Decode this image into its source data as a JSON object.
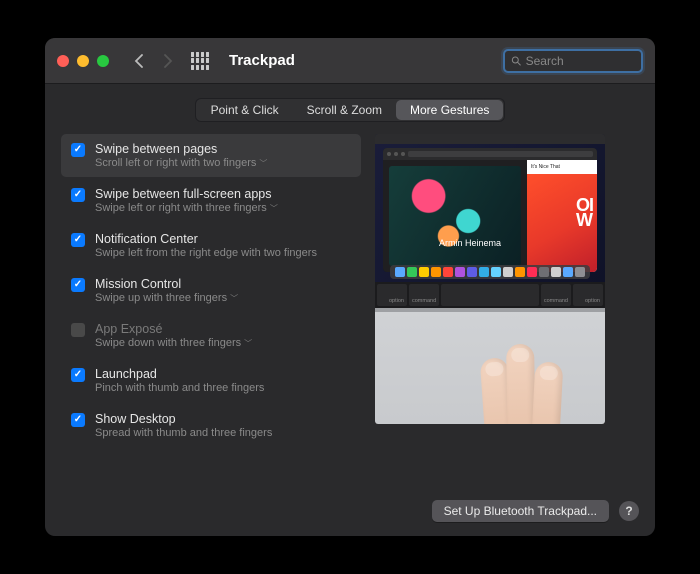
{
  "header": {
    "title": "Trackpad",
    "search_placeholder": "Search"
  },
  "tabs": [
    {
      "label": "Point & Click",
      "active": false
    },
    {
      "label": "Scroll & Zoom",
      "active": false
    },
    {
      "label": "More Gestures",
      "active": true
    }
  ],
  "options": [
    {
      "title": "Swipe between pages",
      "sub": "Scroll left or right with two fingers",
      "checked": true,
      "dropdown": true,
      "selected": true,
      "disabled": false
    },
    {
      "title": "Swipe between full-screen apps",
      "sub": "Swipe left or right with three fingers",
      "checked": true,
      "dropdown": true,
      "selected": false,
      "disabled": false
    },
    {
      "title": "Notification Center",
      "sub": "Swipe left from the right edge with two fingers",
      "checked": true,
      "dropdown": false,
      "selected": false,
      "disabled": false
    },
    {
      "title": "Mission Control",
      "sub": "Swipe up with three fingers",
      "checked": true,
      "dropdown": true,
      "selected": false,
      "disabled": false
    },
    {
      "title": "App Exposé",
      "sub": "Swipe down with three fingers",
      "checked": false,
      "dropdown": true,
      "selected": false,
      "disabled": true
    },
    {
      "title": "Launchpad",
      "sub": "Pinch with thumb and three fingers",
      "checked": true,
      "dropdown": false,
      "selected": false,
      "disabled": false
    },
    {
      "title": "Show Desktop",
      "sub": "Spread with thumb and three fingers",
      "checked": true,
      "dropdown": false,
      "selected": false,
      "disabled": false
    }
  ],
  "preview": {
    "person_name": "Armin Heinema",
    "right_header": "It's Nice That",
    "big_text": "OI\nW",
    "keys": [
      "option",
      "command",
      "",
      "command",
      "option"
    ],
    "dock_colors": [
      "#5aa9ff",
      "#34c759",
      "#ffcc00",
      "#ff9500",
      "#ff453a",
      "#af52de",
      "#5e5ce6",
      "#32ade6",
      "#64d2ff",
      "#cfcfcf",
      "#ff9500",
      "#ff2d55",
      "#6e6e73",
      "#cfcfcf",
      "#5aa9ff",
      "#8e8e93"
    ]
  },
  "footer": {
    "bluetooth_label": "Set Up Bluetooth Trackpad...",
    "help": "?"
  }
}
